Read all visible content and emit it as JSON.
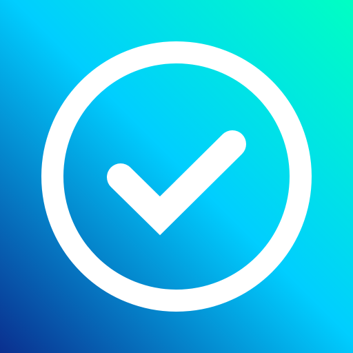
{
  "app_icon": {
    "icon": "check-circle-icon",
    "gradient": {
      "start_color": "#0a2f8f",
      "mid_color": "#00ceff",
      "end_color": "#00ffc3"
    },
    "foreground_color": "#ffffff"
  }
}
